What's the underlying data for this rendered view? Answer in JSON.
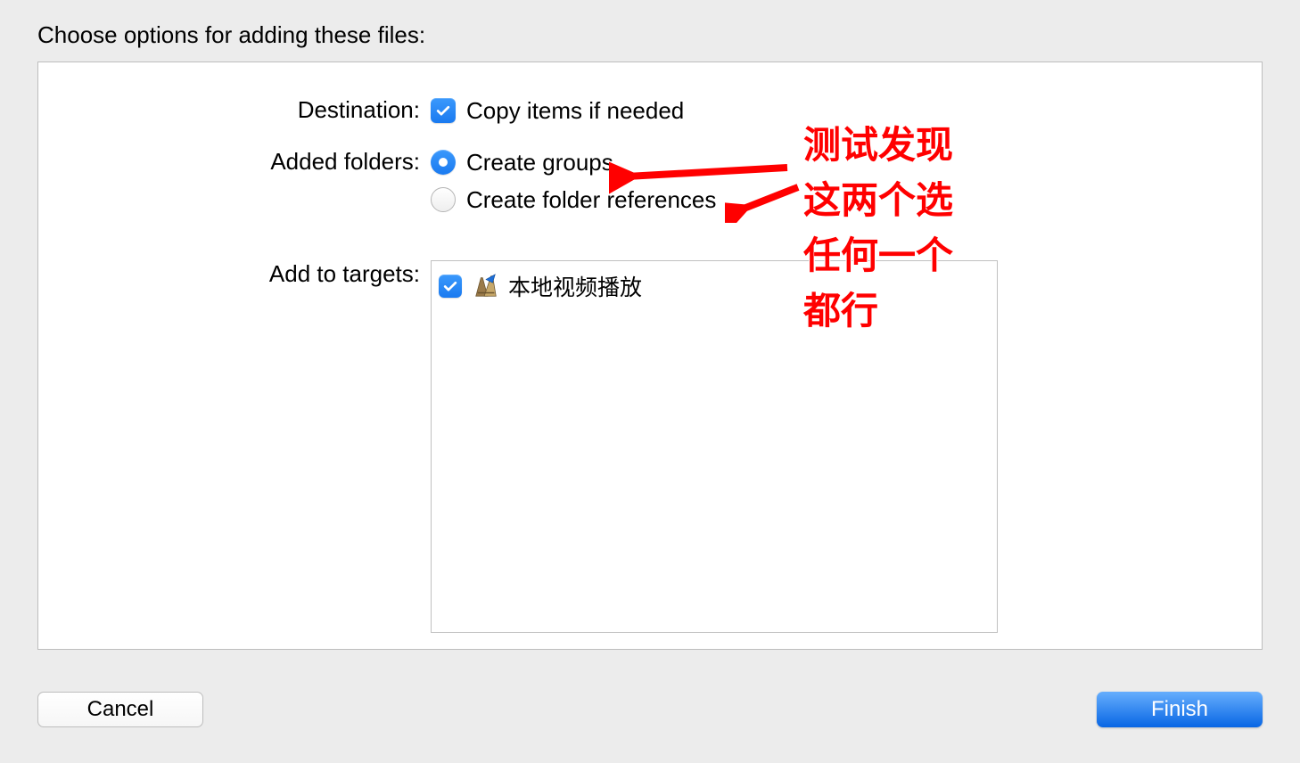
{
  "dialog": {
    "title": "Choose options for adding these files:"
  },
  "destination": {
    "label": "Destination:",
    "copy_items_label": "Copy items if needed"
  },
  "added_folders": {
    "label": "Added folders:",
    "create_groups_label": "Create groups",
    "create_folder_refs_label": "Create folder references"
  },
  "add_to_targets": {
    "label": "Add to targets:",
    "targets": [
      {
        "name": "本地视频播放"
      }
    ]
  },
  "footer": {
    "cancel_label": "Cancel",
    "finish_label": "Finish"
  },
  "annotation": {
    "line1": "测试发现",
    "line2": "这两个选",
    "line3": "任何一个",
    "line4": "都行"
  }
}
